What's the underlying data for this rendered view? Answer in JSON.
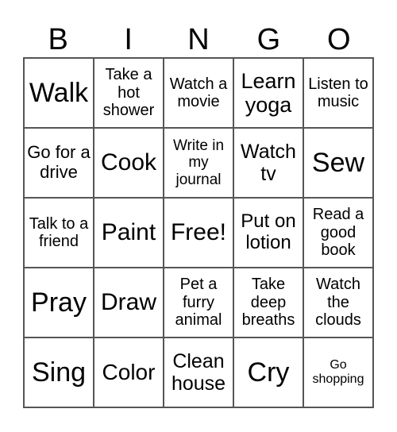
{
  "header": [
    "B",
    "I",
    "N",
    "G",
    "O"
  ],
  "cells": [
    "Walk",
    "Take a hot shower",
    "Watch a movie",
    "Learn yoga",
    "Listen to music",
    "Go for a drive",
    "Cook",
    "Write in my journal",
    "Watch tv",
    "Sew",
    "Talk to a friend",
    "Paint",
    "Free!",
    "Put on lotion",
    "Read a good book",
    "Pray",
    "Draw",
    "Pet a furry animal",
    "Take deep breaths",
    "Watch the clouds",
    "Sing",
    "Color",
    "Clean house",
    "Cry",
    "Go shopping"
  ]
}
